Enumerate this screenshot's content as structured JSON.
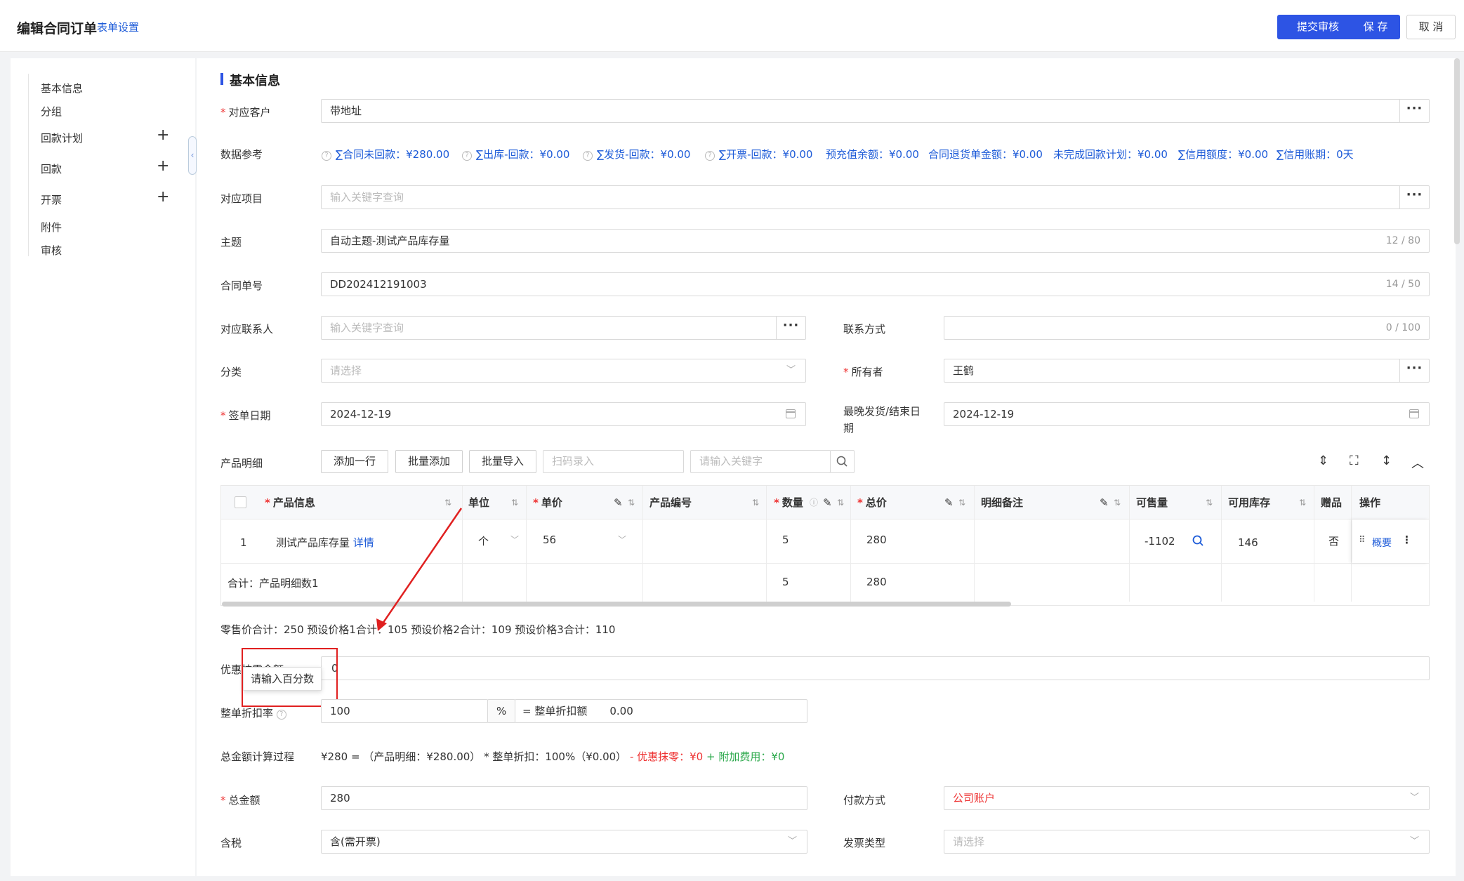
{
  "header": {
    "title": "编辑合同订单",
    "form_settings": "表单设置",
    "submit_review": "提交审核",
    "save": "保 存",
    "cancel": "取 消"
  },
  "sidebar": {
    "items": [
      {
        "label": "基本信息",
        "expandable": false
      },
      {
        "label": "分组",
        "expandable": false
      },
      {
        "label": "回款计划",
        "expandable": true
      },
      {
        "label": "回款",
        "expandable": true
      },
      {
        "label": "开票",
        "expandable": true
      },
      {
        "label": "附件",
        "expandable": false
      },
      {
        "label": "审核",
        "expandable": false
      }
    ],
    "plus": "+"
  },
  "section": {
    "title": "基本信息"
  },
  "form": {
    "customer": {
      "label": "对应客户",
      "value": "带地址"
    },
    "data_ref": {
      "label": "数据参考",
      "items": [
        "∑合同未回款：¥280.00",
        "∑出库-回款：¥0.00",
        "∑发货-回款：¥0.00",
        "∑开票-回款：¥0.00",
        "预充值余额：¥0.00",
        "合同退货单金额：¥0.00",
        "未完成回款计划：¥0.00",
        "∑信用额度：¥0.00",
        "∑信用账期：0天"
      ]
    },
    "project": {
      "label": "对应项目",
      "placeholder": "输入关键字查询"
    },
    "subject": {
      "label": "主题",
      "value": "自动主题-测试产品库存量",
      "count": "12 / 80"
    },
    "contract_no": {
      "label": "合同单号",
      "value": "DD202412191003",
      "count": "14 / 50"
    },
    "contact": {
      "label": "对应联系人",
      "placeholder": "输入关键字查询"
    },
    "contact_method": {
      "label": "联系方式",
      "count": "0 / 100"
    },
    "category": {
      "label": "分类",
      "placeholder": "请选择"
    },
    "owner": {
      "label": "所有者",
      "value": "王鹤"
    },
    "sign_date": {
      "label": "签单日期",
      "value": "2024-12-19"
    },
    "latest_date": {
      "label_line1": "最晚发货/结束日",
      "label_line2": "期",
      "value": "2024-12-19"
    },
    "product_detail": {
      "label": "产品明细"
    },
    "add_row": "添加一行",
    "batch_add": "批量添加",
    "batch_import": "批量导入",
    "scan_placeholder": "扫码录入",
    "keyword_placeholder": "请输入关键字",
    "discount_zero": {
      "label": "优惠抹零金额",
      "value": "0"
    },
    "overall_discount": {
      "label": "整单折扣率",
      "value": "100",
      "unit": "%",
      "amount_label": "= 整单折扣额",
      "amount_value": "0.00"
    },
    "calc_process": {
      "label": "总金额计算过程",
      "part1": "¥280 =  （产品明细：¥280.00）",
      "part2": " * 整单折扣：100%（¥0.00）",
      "part3": " - 优惠抹零：¥0",
      "part4": " + 附加费用：¥0"
    },
    "total_amount": {
      "label": "总金额",
      "value": "280"
    },
    "payment_method": {
      "label": "付款方式",
      "value": "公司账户"
    },
    "tax": {
      "label": "含税",
      "value": "含(需开票)"
    },
    "invoice_type": {
      "label": "发票类型",
      "placeholder": "请选择"
    }
  },
  "table": {
    "headers": {
      "product_info": "产品信息",
      "unit": "单位",
      "price": "单价",
      "product_code": "产品编号",
      "qty": "数量",
      "total": "总价",
      "remark": "明细备注",
      "saleable": "可售量",
      "stock": "可用库存",
      "gift": "赠品",
      "action": "操作"
    },
    "rows": [
      {
        "index": "1",
        "product": "测试产品库存量",
        "detail_link": "详情",
        "unit": "个",
        "price": "56",
        "product_code": "",
        "qty": "5",
        "total": "280",
        "remark": "",
        "saleable": "-1102",
        "stock": "146",
        "gift": "否",
        "action_link": "概要"
      }
    ],
    "summary": {
      "label": "合计：产品明细数1",
      "qty": "5",
      "total": "280"
    }
  },
  "price_summary": "零售价合计：250  预设价格1合计：105  预设价格2合计：109  预设价格3合计：110",
  "tooltip": "请输入百分数",
  "colors": {
    "primary": "#2d54e4",
    "link": "#1d5bd8",
    "required": "#e33333",
    "annotation": "#e02020",
    "green": "#2aa84a"
  }
}
